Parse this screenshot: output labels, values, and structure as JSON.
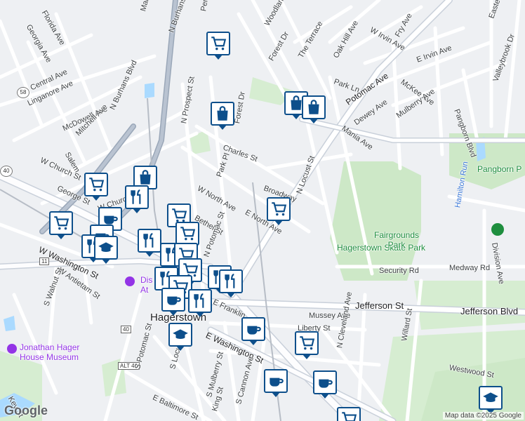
{
  "map": {
    "attribution": "Map data ©2025 Google",
    "logo": "Google",
    "city_label": "Hagerstown",
    "parks": [
      "Hagerstown Skate Park",
      "Fairgrounds Park",
      "Pangborn P"
    ],
    "pois": [
      "Jonathan Hager House Museum",
      "Dis At"
    ],
    "route_shields": [
      "58",
      "40",
      "11",
      "40",
      "ALT 40",
      "ALT 40"
    ],
    "streets": [
      "Florida Ave",
      "Georgia Ave",
      "Central Ave",
      "Linganore Ave",
      "McDowell Ave",
      "Mitchell Ave",
      "Salem",
      "W Church St",
      "George St",
      "W Church St",
      "W Washington St",
      "W Antietam St",
      "S Walnut St",
      "N Burhans Blvd",
      "N Burhans Blvd",
      "N Prospect St",
      "Forest Dr",
      "Charles St",
      "Park Pl",
      "W North Ave",
      "Bethel St",
      "N Potomac St",
      "E North Ave",
      "Broadway",
      "N Locust St",
      "Woodland Way",
      "Forest Dr",
      "The Terrace",
      "Oak Hill Ave",
      "W Irvin Ave",
      "Fry Ave",
      "E Irvin Ave",
      "Park Ln",
      "Potomac Ave",
      "McKee Ave",
      "Dewey Ave",
      "Mulberry Ave",
      "Mania Ave",
      "Pangborn Blvd",
      "Valleybrook Dr",
      "Hamilton Run",
      "Division Ave",
      "Security Rd",
      "Medway Rd",
      "Jefferson St",
      "Jefferson Blvd",
      "Mussey Ave",
      "Liberty St",
      "N Cleveland Ave",
      "Willard St",
      "Westwood St",
      "E Washington St",
      "S Potomac St",
      "S Locust St",
      "S Mulberry St",
      "E Baltimore St",
      "King St",
      "S Cannon Ave",
      "E Franklin",
      "Key St",
      "Eastern Blvd",
      "Pennsylvania",
      "Marsh"
    ]
  }
}
